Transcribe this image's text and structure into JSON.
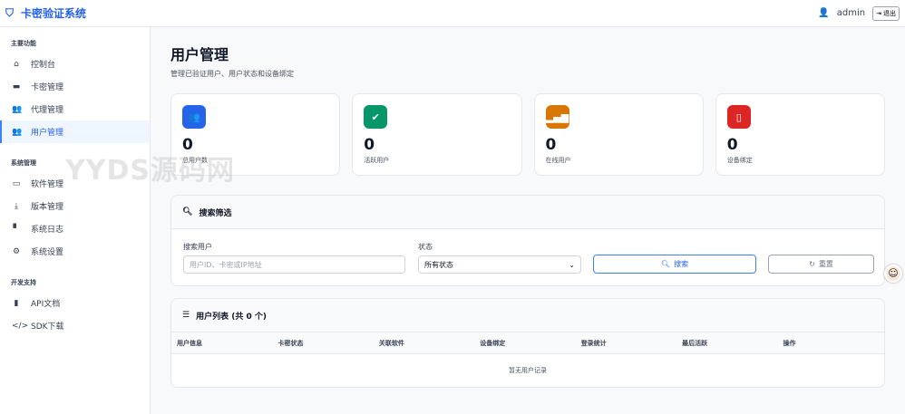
{
  "app": {
    "title": "卡密验证系统",
    "user": "admin",
    "logout": "退出"
  },
  "sidebar": {
    "sections": [
      {
        "title": "主要功能",
        "items": [
          {
            "label": "控制台",
            "icon": "home-icon"
          },
          {
            "label": "卡密管理",
            "icon": "card-icon"
          },
          {
            "label": "代理管理",
            "icon": "users-group-icon"
          },
          {
            "label": "用户管理",
            "icon": "users-icon"
          }
        ]
      },
      {
        "title": "系统管理",
        "items": [
          {
            "label": "软件管理",
            "icon": "laptop-icon"
          },
          {
            "label": "版本管理",
            "icon": "download-icon"
          },
          {
            "label": "系统日志",
            "icon": "file-icon"
          },
          {
            "label": "系统设置",
            "icon": "gear-icon"
          }
        ]
      },
      {
        "title": "开发支持",
        "items": [
          {
            "label": "API文档",
            "icon": "book-icon"
          },
          {
            "label": "SDK下载",
            "icon": "code-icon"
          }
        ]
      }
    ]
  },
  "page": {
    "title": "用户管理",
    "subtitle": "管理已验证用户、用户状态和设备绑定"
  },
  "stats": [
    {
      "value": "0",
      "label": "总用户数",
      "color": "#2563eb"
    },
    {
      "value": "0",
      "label": "活跃用户",
      "color": "#059669"
    },
    {
      "value": "0",
      "label": "在线用户",
      "color": "#d97706"
    },
    {
      "value": "0",
      "label": "设备绑定",
      "color": "#dc2626"
    }
  ],
  "filter": {
    "title": "搜索筛选",
    "search_label": "搜索用户",
    "search_placeholder": "用户ID、卡密或IP地址",
    "status_label": "状态",
    "status_value": "所有状态",
    "search_button": "搜索",
    "reset_button": "重置"
  },
  "table": {
    "title": "用户列表 (共 0 个)",
    "columns": [
      "用户信息",
      "卡密状态",
      "关联软件",
      "设备绑定",
      "登录统计",
      "最后活跃",
      "操作"
    ],
    "empty": "暂无用户记录"
  },
  "watermark": "YYDS源码网"
}
